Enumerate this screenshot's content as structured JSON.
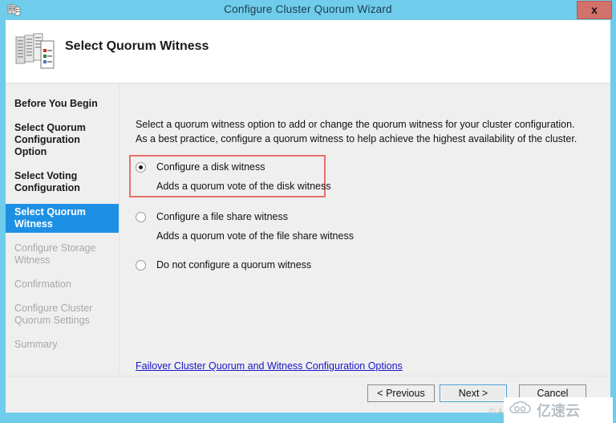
{
  "window": {
    "title": "Configure Cluster Quorum Wizard",
    "title_icon": "cluster-icon",
    "close_label": "x"
  },
  "header": {
    "title": "Select Quorum Witness",
    "icon": "server-cluster-icon"
  },
  "sidebar": {
    "items": [
      {
        "label": "Before You Begin",
        "state": "done"
      },
      {
        "label": "Select Quorum\nConfiguration Option",
        "state": "done"
      },
      {
        "label": "Select Voting\nConfiguration",
        "state": "done"
      },
      {
        "label": "Select Quorum\nWitness",
        "state": "active"
      },
      {
        "label": "Configure Storage\nWitness",
        "state": "pending"
      },
      {
        "label": "Confirmation",
        "state": "pending"
      },
      {
        "label": "Configure Cluster\nQuorum Settings",
        "state": "pending"
      },
      {
        "label": "Summary",
        "state": "pending"
      }
    ]
  },
  "content": {
    "intro": "Select a quorum witness option to add or change the quorum witness for your cluster configuration. As a best practice, configure a quorum witness to help achieve the highest availability of the cluster.",
    "options": [
      {
        "label": "Configure a disk witness",
        "description": "Adds a quorum vote of the disk witness",
        "selected": true,
        "highlighted": true
      },
      {
        "label": "Configure a file share witness",
        "description": "Adds a quorum vote of the file share witness",
        "selected": false,
        "highlighted": false
      },
      {
        "label": "Do not configure a quorum witness",
        "description": "",
        "selected": false,
        "highlighted": false
      }
    ],
    "help_link": "Failover Cluster Quorum and Witness Configuration Options"
  },
  "footer": {
    "previous_label": "< Previous",
    "next_label": "Next >",
    "cancel_label": "Cancel"
  },
  "overlay": {
    "copyright": "© Alb",
    "watermark_text": "亿速云",
    "watermark_icon": "cloud-icon"
  },
  "colors": {
    "titlebar": "#6fcdeb",
    "close_button": "#d3716b",
    "sidebar_active": "#1e90e4",
    "annotation": "#e8706a",
    "link": "#1616c8"
  }
}
